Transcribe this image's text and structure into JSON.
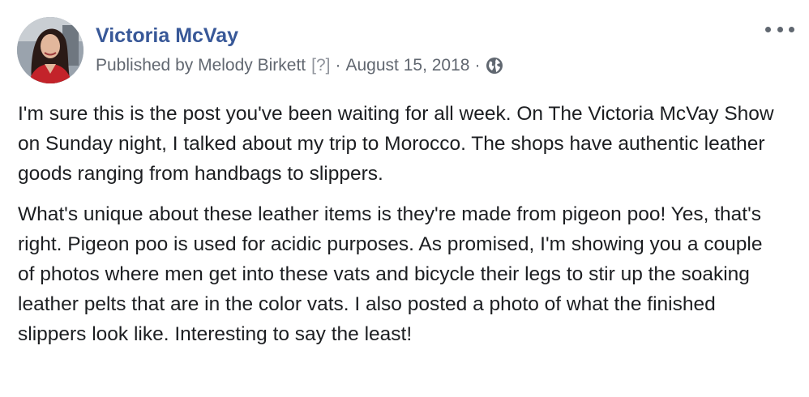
{
  "post": {
    "author": "Victoria McVay",
    "published_by_prefix": "Published by",
    "publisher": "Melody Birkett",
    "help_marker": "[?]",
    "separator": "·",
    "date": "August 15, 2018",
    "audience_icon": "globe-icon",
    "menu_icon": "more-options-icon",
    "paragraphs": [
      "I'm sure this is the post you've been waiting for all week. On The Victoria McVay Show on Sunday night, I talked about my trip to Morocco. The shops have authentic leather goods ranging from handbags to slippers.",
      "What's unique about these leather items is they're made from pigeon poo! Yes, that's right. Pigeon poo is used for acidic purposes. As promised, I'm showing you a couple of photos where men get into these vats and bicycle their legs to stir up the soaking leather pelts that are in the color vats. I also posted a photo of what the finished slippers look like. Interesting to say the least!"
    ]
  },
  "colors": {
    "author_link": "#385898",
    "meta_text": "#616770",
    "body_text": "#1c1e21"
  }
}
